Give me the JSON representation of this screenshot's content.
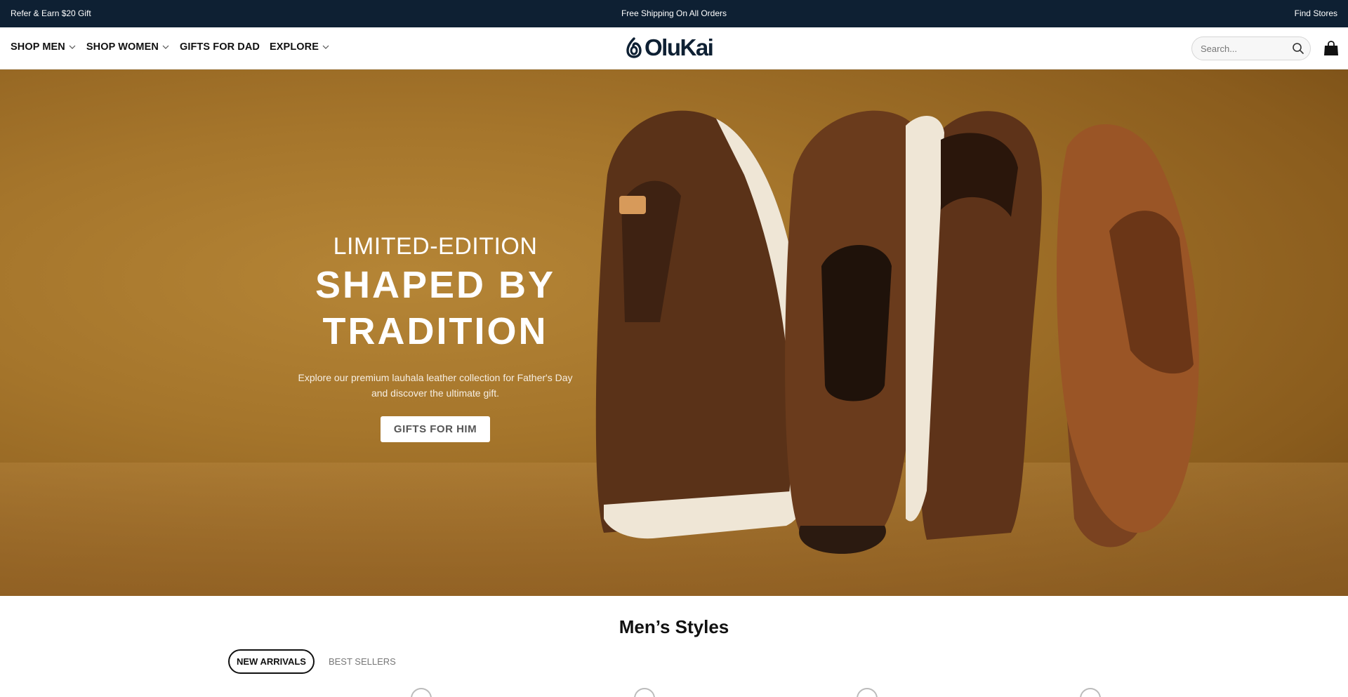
{
  "announcement": {
    "left": "Refer & Earn $20 Gift",
    "center": "Free Shipping On All Orders",
    "right": "Find Stores"
  },
  "header": {
    "nav": [
      {
        "label": "SHOP MEN",
        "has_dropdown": true
      },
      {
        "label": "SHOP WOMEN",
        "has_dropdown": true
      },
      {
        "label": "GIFTS FOR DAD",
        "has_dropdown": false
      },
      {
        "label": "EXPLORE",
        "has_dropdown": true
      }
    ],
    "logo_text": "OluKai",
    "search": {
      "placeholder": "Search..."
    },
    "icons": {
      "search": "search-icon",
      "cart": "shopping-bag-icon"
    }
  },
  "hero": {
    "eyebrow": "LIMITED-EDITION",
    "headline_line1": "SHAPED BY",
    "headline_line2": "TRADITION",
    "subtext_line1": "Explore our premium lauhala leather collection for Father's Day",
    "subtext_line2": "and discover the ultimate gift.",
    "cta_label": "GIFTS FOR HIM"
  },
  "section": {
    "title": "Men’s Styles",
    "tabs": [
      {
        "label": "NEW ARRIVALS",
        "active": true
      },
      {
        "label": "BEST SELLERS",
        "active": false
      }
    ]
  },
  "colors": {
    "announce_bg": "#0e2033",
    "logo": "#0e2033",
    "hero_bg": "#a5752b"
  }
}
